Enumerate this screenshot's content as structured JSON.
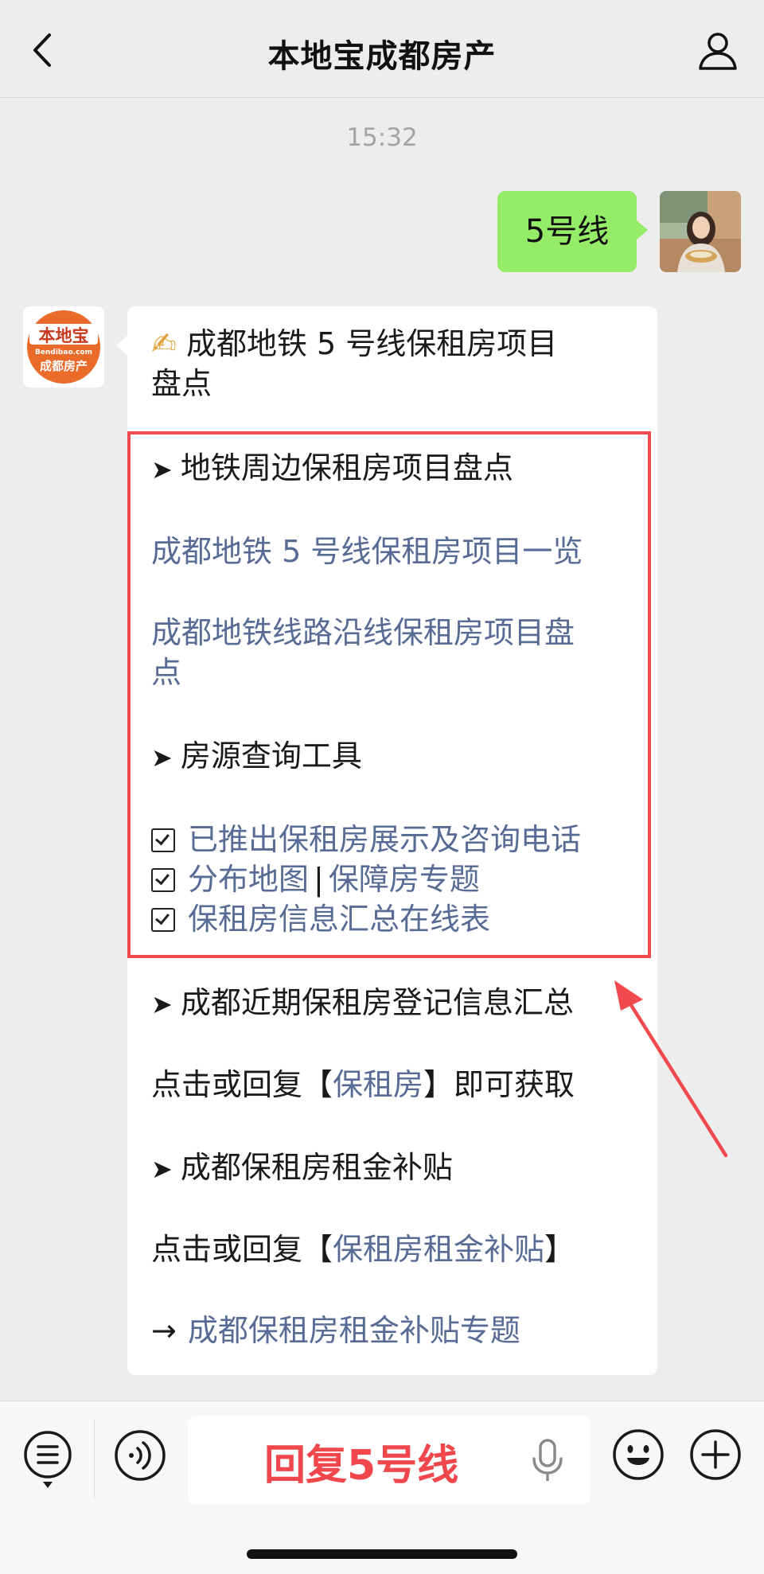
{
  "header": {
    "title": "本地宝成都房产",
    "back_icon": "chevron-left-icon",
    "profile_icon": "person-icon"
  },
  "chat": {
    "timestamp": "15:32",
    "user_message": "5号线",
    "bot_avatar": {
      "logo_top": "本地宝",
      "logo_domain": "Bendibao.com",
      "logo_bottom": "成都房产"
    },
    "bot_message": {
      "title_emoji": "✍",
      "title": "成都地铁 5 号线保租房项目",
      "title_cont": "盘点",
      "section1": "地铁周边保租房项目盘点",
      "link1": "成都地铁 5 号线保租房项目一览",
      "link2_line1": "成都地铁线路沿线保租房项目盘",
      "link2_line2": "点",
      "section2": "房源查询工具",
      "check1": "已推出保租房展示及咨询电话",
      "check2a": "分布地图",
      "check2_sep": "|",
      "check2b": "保障房专题",
      "check3": "保租房信息汇总在线表",
      "section3": "成都近期保租房登记信息汇总",
      "text1_pre": "点击或回复【",
      "text1_link": "保租房",
      "text1_post": "】即可获取",
      "section4": "成都保租房租金补贴",
      "text2_pre": "点击或回复【",
      "text2_link": "保租房租金补贴",
      "text2_post": "】",
      "arrow_symbol": "→",
      "link3": "成都保租房租金补贴专题",
      "bullet_symbol": "➤"
    }
  },
  "input_bar": {
    "menu_icon": "list-menu-icon",
    "voice_icon": "voice-mode-icon",
    "value": "回复5号线",
    "mic_icon": "microphone-icon",
    "emoji_icon": "emoji-smile-icon",
    "plus_icon": "plus-circle-icon"
  },
  "colors": {
    "background": "#ededed",
    "user_bubble": "#95ec69",
    "link": "#576b95",
    "highlight_frame": "#f04a4f",
    "input_text": "#f0474d"
  }
}
